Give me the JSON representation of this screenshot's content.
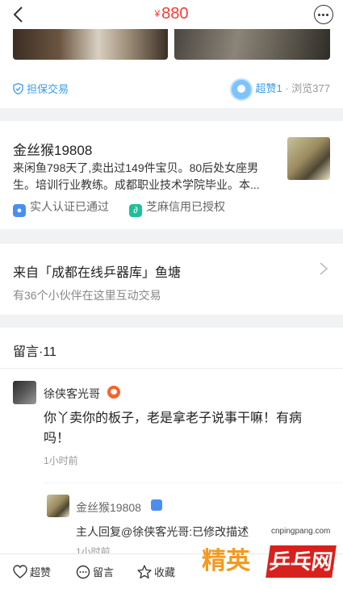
{
  "header": {
    "currency": "¥",
    "price": "880"
  },
  "item": {
    "guarantee": "担保交易",
    "likes_label": "超赞1",
    "separator": " · ",
    "views_label": "浏览377"
  },
  "seller": {
    "name": "金丝猴19808",
    "bio": "来闲鱼798天了,卖出过149件宝贝。80后处女座男生。培训行业教练。成都职业技术学院毕业。本...",
    "badges": [
      {
        "icon": "id-verified-icon",
        "label": "实人认证已通过"
      },
      {
        "icon": "zhima-credit-icon",
        "label": "芝麻信用已授权"
      }
    ]
  },
  "pond": {
    "title": "来自「成都在线乒器库」鱼塘",
    "subtitle": "有36个小伙伴在这里互动交易"
  },
  "comments": {
    "title": "留言·11",
    "items": [
      {
        "name": "徐侠客光哥",
        "text": "你丫卖你的板子，老是拿老子说事干嘛！有病吗！",
        "time": "1小时前"
      }
    ],
    "reply": {
      "name": "金丝猴19808",
      "text": "主人回复@徐侠客光哥:已修改描述",
      "time": "1小时前"
    }
  },
  "bottom_bar": {
    "like": "超赞",
    "comment": "留言",
    "favorite": "收藏"
  },
  "watermark": {
    "url": "cnpingpang.com",
    "left_text": "精英",
    "right_text": "乒乓网"
  },
  "colors": {
    "price": "#ff3b30",
    "link_blue": "#3b9be8",
    "background": "#f1f2f4"
  }
}
